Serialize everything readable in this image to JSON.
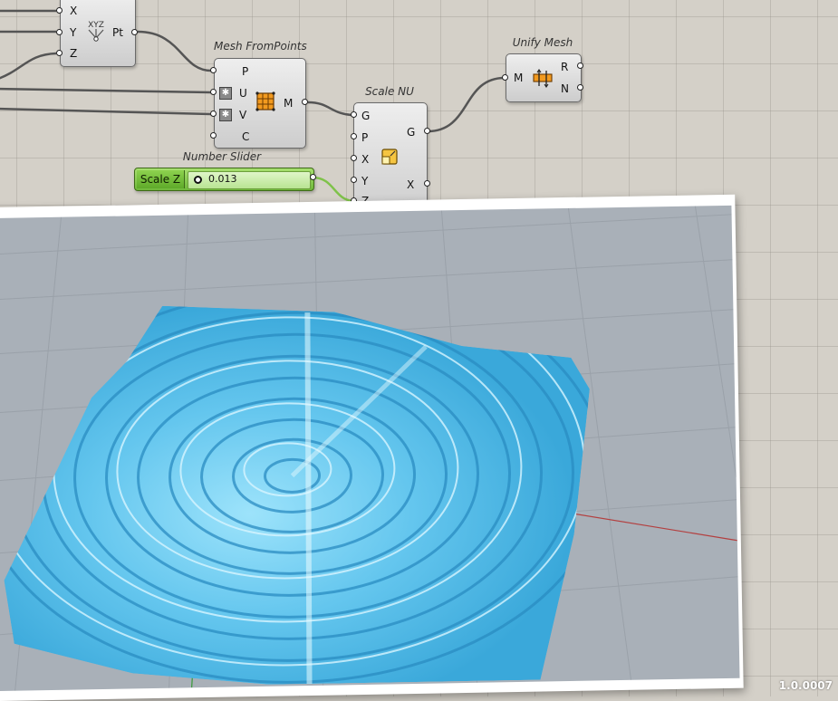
{
  "canvas": {
    "background": "#d4d0c8",
    "wire_color": "#555555",
    "slider_wire_color": "#7fc24a"
  },
  "components": {
    "construct_point": {
      "inputs": [
        "X",
        "Y",
        "Z"
      ],
      "output": "Pt",
      "icon_text": "XYZ",
      "icon": "construct-point-icon"
    },
    "mesh_from_points": {
      "title": "Mesh FromPoints",
      "inputs": [
        "P",
        "U",
        "V",
        "C"
      ],
      "output": "M",
      "icon": "mesh-grid-icon"
    },
    "scale_nu": {
      "title": "Scale NU",
      "inputs": [
        "G",
        "P",
        "X",
        "Y",
        "Z"
      ],
      "outputs": [
        "G",
        "X"
      ],
      "icon": "scale-icon"
    },
    "unify_mesh": {
      "title": "Unify Mesh",
      "input": "M",
      "outputs": [
        "R",
        "N"
      ],
      "icon": "unify-mesh-icon"
    }
  },
  "number_slider": {
    "title": "Number Slider",
    "label": "Scale Z",
    "value": "0.013",
    "accent": "#7fc24a"
  },
  "viewport": {
    "background": "#a9b0b8",
    "mesh_color": "#6ccff2"
  },
  "version_label": "1.0.0007"
}
